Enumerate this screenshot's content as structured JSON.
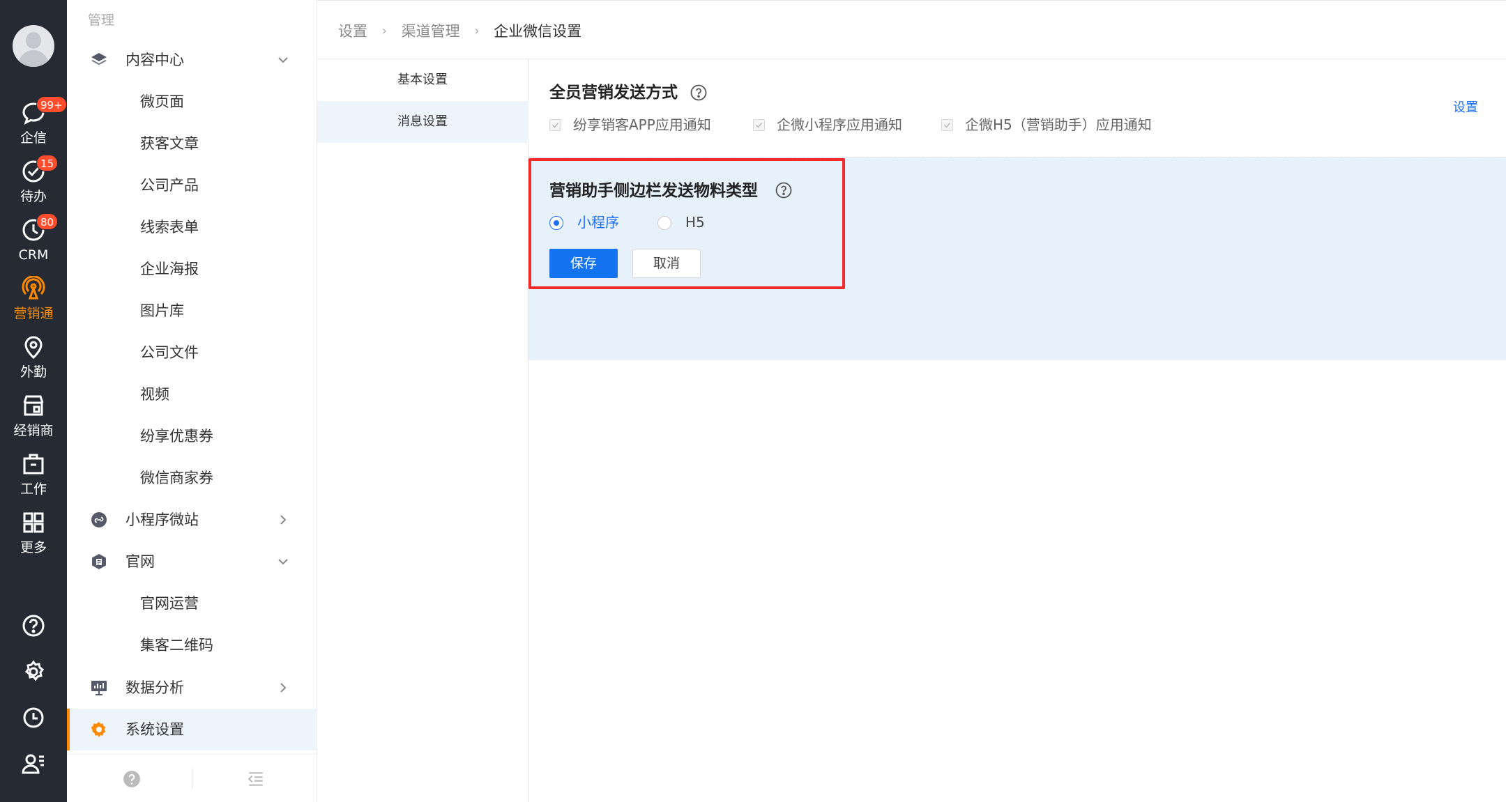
{
  "rail": {
    "items": [
      {
        "icon": "chat-bubble-icon",
        "label": "企信",
        "badge": "99+"
      },
      {
        "icon": "check-circle-icon",
        "label": "待办",
        "badge": "15"
      },
      {
        "icon": "clock-icon",
        "label": "CRM",
        "badge": "80"
      },
      {
        "icon": "broadcast-icon",
        "label": "营销通",
        "badge": ""
      },
      {
        "icon": "location-pin-icon",
        "label": "外勤",
        "badge": ""
      },
      {
        "icon": "store-icon",
        "label": "经销商",
        "badge": ""
      },
      {
        "icon": "briefcase-icon",
        "label": "工作",
        "badge": ""
      },
      {
        "icon": "grid-icon",
        "label": "更多",
        "badge": ""
      }
    ],
    "active_color": "#ff8a00",
    "background": "#262b33"
  },
  "menu": {
    "section": "管理",
    "items": [
      {
        "type": "group",
        "icon": "layers-icon",
        "label": "内容中心",
        "arrow": "down"
      },
      {
        "type": "sub",
        "label": "微页面"
      },
      {
        "type": "sub",
        "label": "获客文章"
      },
      {
        "type": "sub",
        "label": "公司产品"
      },
      {
        "type": "sub",
        "label": "线索表单"
      },
      {
        "type": "sub",
        "label": "企业海报"
      },
      {
        "type": "sub",
        "label": "图片库"
      },
      {
        "type": "sub",
        "label": "公司文件"
      },
      {
        "type": "sub",
        "label": "视频"
      },
      {
        "type": "sub",
        "label": "纷享优惠券"
      },
      {
        "type": "sub",
        "label": "微信商家券"
      },
      {
        "type": "group",
        "icon": "mini-program-icon",
        "label": "小程序微站",
        "arrow": "right"
      },
      {
        "type": "group",
        "icon": "website-icon",
        "label": "官网",
        "arrow": "down"
      },
      {
        "type": "sub",
        "label": "官网运营"
      },
      {
        "type": "sub",
        "label": "集客二维码"
      },
      {
        "type": "group",
        "icon": "data-analysis-icon",
        "label": "数据分析",
        "arrow": "right"
      },
      {
        "type": "group",
        "icon": "gear-icon",
        "label": "系统设置",
        "arrow": ""
      }
    ]
  },
  "breadcrumb": [
    "设置",
    "渠道管理",
    "企业微信设置"
  ],
  "tabs": [
    "基本设置",
    "消息设置"
  ],
  "content": {
    "section1": {
      "title": "全员营销发送方式",
      "options": [
        "纷享销客APP应用通知",
        "企微小程序应用通知",
        "企微H5（营销助手）应用通知"
      ],
      "settings_link": "设置"
    },
    "section2": {
      "title": "营销助手侧边栏发送物料类型",
      "radio_selected": "小程序",
      "radio_other": "H5",
      "save": "保存",
      "cancel": "取消"
    },
    "accent": "#1473f0",
    "highlight": "#f02b2b"
  }
}
